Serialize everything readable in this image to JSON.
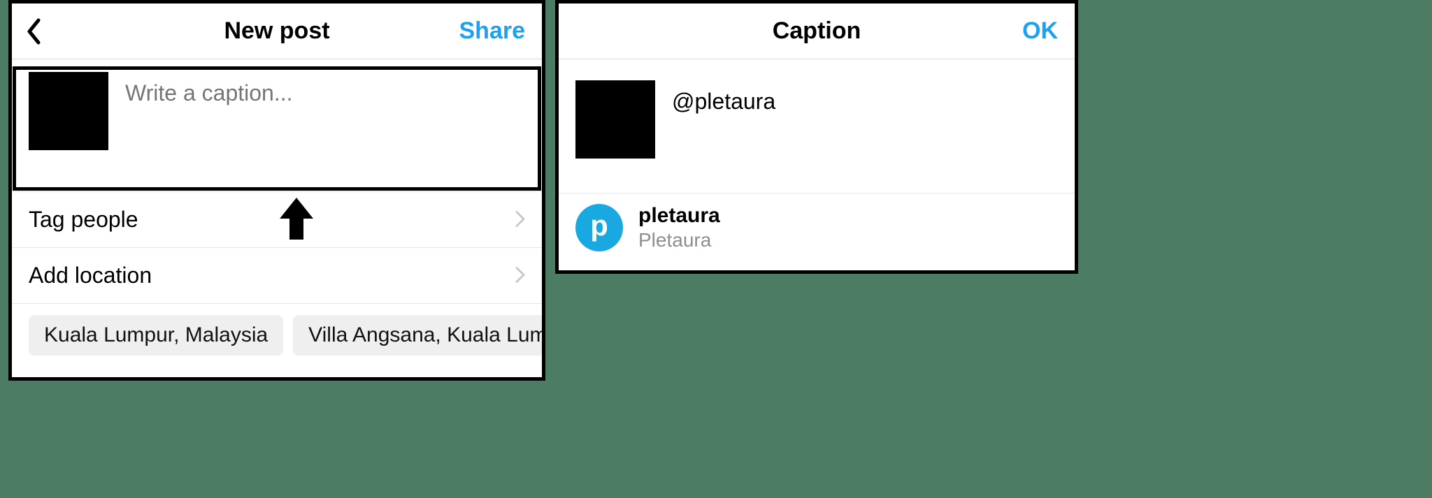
{
  "left": {
    "header": {
      "title": "New post",
      "action": "Share"
    },
    "caption_placeholder": "Write a caption...",
    "rows": {
      "tag_people": "Tag people",
      "add_location": "Add location"
    },
    "location_chips": [
      "Kuala Lumpur, Malaysia",
      "Villa Angsana, Kuala Lumpur"
    ]
  },
  "right": {
    "header": {
      "title": "Caption",
      "action": "OK"
    },
    "caption_value": "@pletaura",
    "suggestion": {
      "avatar_letter": "p",
      "username": "pletaura",
      "display_name": "Pletaura"
    }
  }
}
